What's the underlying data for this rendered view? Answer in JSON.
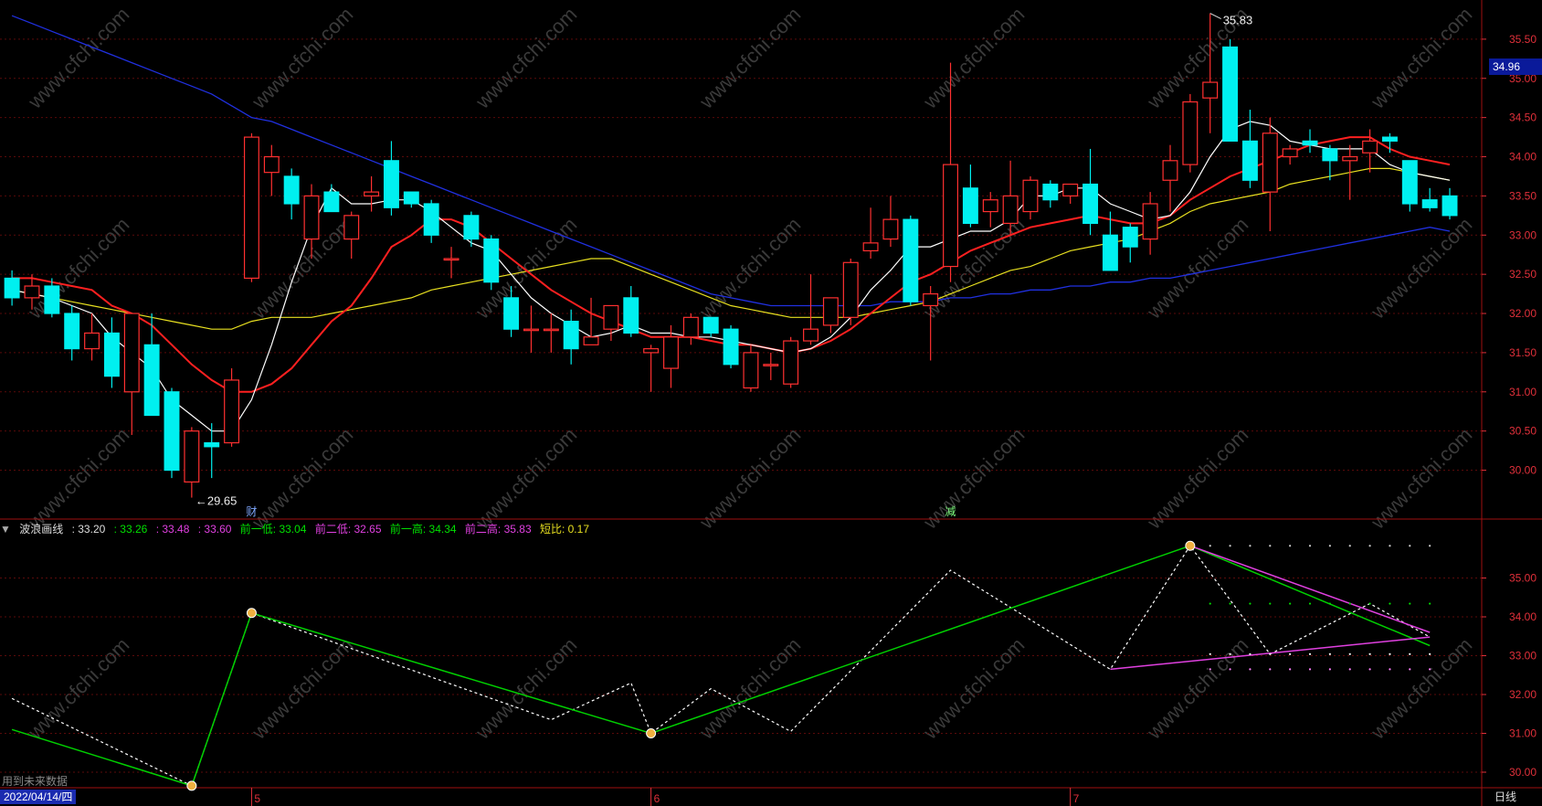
{
  "colors": {
    "up": "#ff3030",
    "down": "#00f0f0",
    "grid": "#5a0a0a",
    "axis": "#e0303a",
    "ma5": "#ffffff",
    "ma10": "#ff2020",
    "ma20": "#e8e020",
    "ma60": "#2030e0",
    "wave_main": "#00d000",
    "wave_dash": "#ffffff",
    "wave_upper": "#e040e0"
  },
  "header": {
    "indicator_name": "波浪画线",
    "value_main": ": 33.20",
    "value_a": ": 33.26",
    "value_b": ": 33.48",
    "value_c": ": 33.60",
    "prev_low1": "前一低: 33.04",
    "prev_low2": "前二低: 32.65",
    "prev_high1": "前一高: 34.34",
    "prev_high2": "前二高: 35.83",
    "ratio": "短比: 0.17"
  },
  "current_price": "34.96",
  "cursor_date": "2022/04/14/四",
  "period": "日线",
  "future_note": "用到未来数据",
  "annotations": {
    "high": "35.83",
    "low": "29.65",
    "marker_cai": "财",
    "marker_jian": "减"
  },
  "chart_data": {
    "type": "candlestick",
    "main_axis": {
      "ticks": [
        "30.00",
        "30.50",
        "31.00",
        "31.50",
        "32.00",
        "32.50",
        "33.00",
        "33.50",
        "34.00",
        "34.50",
        "35.00",
        "35.50"
      ],
      "ylim": [
        29.4,
        36.0
      ]
    },
    "sub_axis": {
      "ticks": [
        "30.00",
        "31.00",
        "32.00",
        "33.00",
        "34.00",
        "35.00"
      ],
      "ylim": [
        29.6,
        36.0
      ]
    },
    "x_month_labels": [
      {
        "label": "5",
        "index": 12
      },
      {
        "label": "6",
        "index": 32
      },
      {
        "label": "7",
        "index": 53
      }
    ],
    "candles": [
      {
        "o": 32.45,
        "h": 32.55,
        "l": 32.1,
        "c": 32.2
      },
      {
        "o": 32.2,
        "h": 32.5,
        "l": 32.05,
        "c": 32.35
      },
      {
        "o": 32.35,
        "h": 32.45,
        "l": 31.95,
        "c": 32.0
      },
      {
        "o": 32.0,
        "h": 32.1,
        "l": 31.4,
        "c": 31.55
      },
      {
        "o": 31.55,
        "h": 32.0,
        "l": 31.4,
        "c": 31.75
      },
      {
        "o": 31.75,
        "h": 31.95,
        "l": 31.05,
        "c": 31.2
      },
      {
        "o": 31.0,
        "h": 32.0,
        "l": 30.45,
        "c": 32.0
      },
      {
        "o": 31.6,
        "h": 32.0,
        "l": 30.7,
        "c": 30.7
      },
      {
        "o": 31.0,
        "h": 31.05,
        "l": 29.9,
        "c": 30.0
      },
      {
        "o": 29.85,
        "h": 30.55,
        "l": 29.65,
        "c": 30.5
      },
      {
        "o": 30.35,
        "h": 30.6,
        "l": 29.9,
        "c": 30.3
      },
      {
        "o": 30.35,
        "h": 31.3,
        "l": 30.3,
        "c": 31.15
      },
      {
        "o": 32.45,
        "h": 34.3,
        "l": 32.4,
        "c": 34.25
      },
      {
        "o": 33.8,
        "h": 34.15,
        "l": 33.5,
        "c": 34.0
      },
      {
        "o": 33.75,
        "h": 33.85,
        "l": 33.2,
        "c": 33.4
      },
      {
        "o": 32.95,
        "h": 33.65,
        "l": 32.7,
        "c": 33.5
      },
      {
        "o": 33.55,
        "h": 33.65,
        "l": 33.3,
        "c": 33.3
      },
      {
        "o": 32.95,
        "h": 33.3,
        "l": 32.7,
        "c": 33.25
      },
      {
        "o": 33.5,
        "h": 33.75,
        "l": 33.3,
        "c": 33.55
      },
      {
        "o": 33.95,
        "h": 34.2,
        "l": 33.25,
        "c": 33.35
      },
      {
        "o": 33.55,
        "h": 33.55,
        "l": 33.35,
        "c": 33.4
      },
      {
        "o": 33.4,
        "h": 33.45,
        "l": 32.9,
        "c": 33.0
      },
      {
        "o": 32.7,
        "h": 32.85,
        "l": 32.45,
        "c": 32.7
      },
      {
        "o": 33.25,
        "h": 33.3,
        "l": 32.85,
        "c": 32.95
      },
      {
        "o": 32.95,
        "h": 33.0,
        "l": 32.3,
        "c": 32.4
      },
      {
        "o": 32.2,
        "h": 32.35,
        "l": 31.7,
        "c": 31.8
      },
      {
        "o": 31.8,
        "h": 32.1,
        "l": 31.5,
        "c": 31.8
      },
      {
        "o": 31.8,
        "h": 32.0,
        "l": 31.5,
        "c": 31.8
      },
      {
        "o": 31.9,
        "h": 32.05,
        "l": 31.35,
        "c": 31.55
      },
      {
        "o": 31.6,
        "h": 32.2,
        "l": 31.6,
        "c": 31.7
      },
      {
        "o": 31.8,
        "h": 32.1,
        "l": 31.65,
        "c": 32.1
      },
      {
        "o": 32.2,
        "h": 32.35,
        "l": 31.7,
        "c": 31.75
      },
      {
        "o": 31.5,
        "h": 31.6,
        "l": 31.0,
        "c": 31.55
      },
      {
        "o": 31.3,
        "h": 31.85,
        "l": 31.05,
        "c": 31.7
      },
      {
        "o": 31.7,
        "h": 32.0,
        "l": 31.6,
        "c": 31.95
      },
      {
        "o": 31.95,
        "h": 31.95,
        "l": 31.7,
        "c": 31.75
      },
      {
        "o": 31.8,
        "h": 31.85,
        "l": 31.3,
        "c": 31.35
      },
      {
        "o": 31.05,
        "h": 31.6,
        "l": 31.0,
        "c": 31.5
      },
      {
        "o": 31.35,
        "h": 31.5,
        "l": 31.15,
        "c": 31.35
      },
      {
        "o": 31.1,
        "h": 31.7,
        "l": 31.05,
        "c": 31.65
      },
      {
        "o": 31.65,
        "h": 32.5,
        "l": 31.6,
        "c": 31.8
      },
      {
        "o": 31.85,
        "h": 32.2,
        "l": 31.75,
        "c": 32.2
      },
      {
        "o": 31.95,
        "h": 32.7,
        "l": 31.85,
        "c": 32.65
      },
      {
        "o": 32.8,
        "h": 33.35,
        "l": 32.7,
        "c": 32.9
      },
      {
        "o": 32.95,
        "h": 33.5,
        "l": 32.85,
        "c": 33.2
      },
      {
        "o": 33.2,
        "h": 33.25,
        "l": 32.1,
        "c": 32.15
      },
      {
        "o": 32.1,
        "h": 32.35,
        "l": 31.4,
        "c": 32.25
      },
      {
        "o": 32.6,
        "h": 35.2,
        "l": 32.4,
        "c": 33.9
      },
      {
        "o": 33.6,
        "h": 33.9,
        "l": 33.1,
        "c": 33.15
      },
      {
        "o": 33.3,
        "h": 33.55,
        "l": 33.1,
        "c": 33.45
      },
      {
        "o": 33.15,
        "h": 33.95,
        "l": 33.0,
        "c": 33.5
      },
      {
        "o": 33.3,
        "h": 33.75,
        "l": 33.2,
        "c": 33.7
      },
      {
        "o": 33.65,
        "h": 33.7,
        "l": 33.35,
        "c": 33.45
      },
      {
        "o": 33.5,
        "h": 33.65,
        "l": 33.4,
        "c": 33.65
      },
      {
        "o": 33.65,
        "h": 34.1,
        "l": 33.0,
        "c": 33.15
      },
      {
        "o": 33.0,
        "h": 33.3,
        "l": 32.8,
        "c": 32.55
      },
      {
        "o": 33.1,
        "h": 33.15,
        "l": 32.65,
        "c": 32.85
      },
      {
        "o": 32.95,
        "h": 33.55,
        "l": 32.75,
        "c": 33.4
      },
      {
        "o": 33.7,
        "h": 34.15,
        "l": 33.3,
        "c": 33.95
      },
      {
        "o": 33.9,
        "h": 34.8,
        "l": 33.8,
        "c": 34.7
      },
      {
        "o": 34.75,
        "h": 35.83,
        "l": 34.3,
        "c": 34.95
      },
      {
        "o": 35.4,
        "h": 35.5,
        "l": 34.2,
        "c": 34.2
      },
      {
        "o": 34.2,
        "h": 34.6,
        "l": 33.6,
        "c": 33.7
      },
      {
        "o": 33.55,
        "h": 34.5,
        "l": 33.05,
        "c": 34.3
      },
      {
        "o": 34.0,
        "h": 34.15,
        "l": 33.9,
        "c": 34.1
      },
      {
        "o": 34.2,
        "h": 34.35,
        "l": 34.05,
        "c": 34.15
      },
      {
        "o": 34.1,
        "h": 34.15,
        "l": 33.7,
        "c": 33.95
      },
      {
        "o": 33.95,
        "h": 34.15,
        "l": 33.45,
        "c": 34.0
      },
      {
        "o": 34.05,
        "h": 34.35,
        "l": 33.8,
        "c": 34.2
      },
      {
        "o": 34.25,
        "h": 34.3,
        "l": 34.05,
        "c": 34.2
      },
      {
        "o": 33.95,
        "h": 33.95,
        "l": 33.3,
        "c": 33.4
      },
      {
        "o": 33.45,
        "h": 33.6,
        "l": 33.3,
        "c": 33.35
      },
      {
        "o": 33.5,
        "h": 33.6,
        "l": 33.2,
        "c": 33.25
      }
    ],
    "ma5": [
      32.3,
      32.25,
      32.2,
      32.1,
      32.0,
      31.7,
      31.5,
      31.3,
      30.9,
      30.7,
      30.5,
      30.5,
      30.9,
      31.6,
      32.4,
      33.1,
      33.6,
      33.4,
      33.4,
      33.45,
      33.45,
      33.3,
      33.1,
      32.9,
      32.8,
      32.5,
      32.2,
      32.0,
      31.85,
      31.7,
      31.75,
      31.85,
      31.75,
      31.75,
      31.7,
      31.7,
      31.65,
      31.6,
      31.55,
      31.5,
      31.55,
      31.7,
      31.95,
      32.3,
      32.55,
      32.85,
      32.85,
      32.95,
      33.05,
      33.05,
      33.2,
      33.5,
      33.5,
      33.6,
      33.6,
      33.4,
      33.3,
      33.2,
      33.25,
      33.55,
      34.0,
      34.35,
      34.45,
      34.4,
      34.2,
      34.15,
      34.1,
      34.1,
      34.1,
      33.9,
      33.8,
      33.75,
      33.7
    ],
    "ma10": [
      32.45,
      32.45,
      32.4,
      32.35,
      32.3,
      32.1,
      32.0,
      31.85,
      31.6,
      31.35,
      31.15,
      31.0,
      31.0,
      31.1,
      31.3,
      31.6,
      31.9,
      32.1,
      32.45,
      32.85,
      33.0,
      33.2,
      33.2,
      33.1,
      32.9,
      32.7,
      32.5,
      32.3,
      32.15,
      32.0,
      31.9,
      31.8,
      31.7,
      31.7,
      31.7,
      31.65,
      31.6,
      31.6,
      31.55,
      31.5,
      31.55,
      31.65,
      31.8,
      32.0,
      32.2,
      32.4,
      32.5,
      32.65,
      32.8,
      32.9,
      33.0,
      33.1,
      33.15,
      33.2,
      33.25,
      33.2,
      33.15,
      33.15,
      33.25,
      33.45,
      33.6,
      33.75,
      33.85,
      33.95,
      34.05,
      34.15,
      34.2,
      34.25,
      34.25,
      34.1,
      34.0,
      33.95,
      33.9
    ],
    "ma20": [
      32.3,
      32.25,
      32.2,
      32.15,
      32.1,
      32.05,
      32.0,
      31.95,
      31.9,
      31.85,
      31.8,
      31.8,
      31.9,
      31.95,
      31.95,
      31.95,
      32.0,
      32.05,
      32.1,
      32.15,
      32.2,
      32.3,
      32.35,
      32.4,
      32.45,
      32.5,
      32.55,
      32.6,
      32.65,
      32.7,
      32.7,
      32.6,
      32.5,
      32.4,
      32.3,
      32.2,
      32.1,
      32.05,
      32.0,
      31.95,
      31.95,
      31.95,
      31.95,
      32.0,
      32.05,
      32.1,
      32.15,
      32.25,
      32.35,
      32.45,
      32.55,
      32.6,
      32.7,
      32.8,
      32.85,
      32.9,
      32.95,
      33.05,
      33.15,
      33.3,
      33.4,
      33.45,
      33.5,
      33.55,
      33.65,
      33.7,
      33.75,
      33.8,
      33.85,
      33.85,
      33.8,
      33.75,
      33.7
    ],
    "ma60": [
      35.8,
      35.7,
      35.6,
      35.5,
      35.4,
      35.3,
      35.2,
      35.1,
      35.0,
      34.9,
      34.8,
      34.65,
      34.5,
      34.45,
      34.35,
      34.25,
      34.15,
      34.05,
      33.95,
      33.85,
      33.75,
      33.65,
      33.55,
      33.45,
      33.35,
      33.25,
      33.15,
      33.05,
      32.95,
      32.85,
      32.75,
      32.65,
      32.55,
      32.45,
      32.35,
      32.25,
      32.2,
      32.15,
      32.1,
      32.1,
      32.1,
      32.1,
      32.1,
      32.1,
      32.15,
      32.15,
      32.15,
      32.2,
      32.2,
      32.25,
      32.25,
      32.3,
      32.3,
      32.35,
      32.35,
      32.4,
      32.4,
      32.45,
      32.45,
      32.5,
      32.55,
      32.6,
      32.65,
      32.7,
      32.75,
      32.8,
      32.85,
      32.9,
      32.95,
      33.0,
      33.05,
      33.1,
      33.05
    ],
    "wave_main": [
      [
        0,
        31.1
      ],
      [
        9,
        29.65
      ],
      [
        12,
        34.1
      ],
      [
        32,
        31.0
      ],
      [
        59,
        35.83
      ],
      [
        71,
        33.26
      ]
    ],
    "wave_dash": [
      [
        0,
        31.9
      ],
      [
        9,
        29.65
      ],
      [
        12,
        34.1
      ],
      [
        27,
        31.35
      ],
      [
        31,
        32.3
      ],
      [
        32,
        31.0
      ],
      [
        35,
        32.15
      ],
      [
        39,
        31.05
      ],
      [
        47,
        35.2
      ],
      [
        55,
        32.65
      ],
      [
        59,
        35.83
      ],
      [
        63,
        33.04
      ],
      [
        68,
        34.34
      ],
      [
        71,
        33.48
      ]
    ],
    "wave_upper": [
      [
        59,
        35.83
      ],
      [
        71,
        33.6
      ]
    ],
    "wave_lower": [
      [
        55,
        32.65
      ],
      [
        71,
        33.48
      ]
    ]
  }
}
